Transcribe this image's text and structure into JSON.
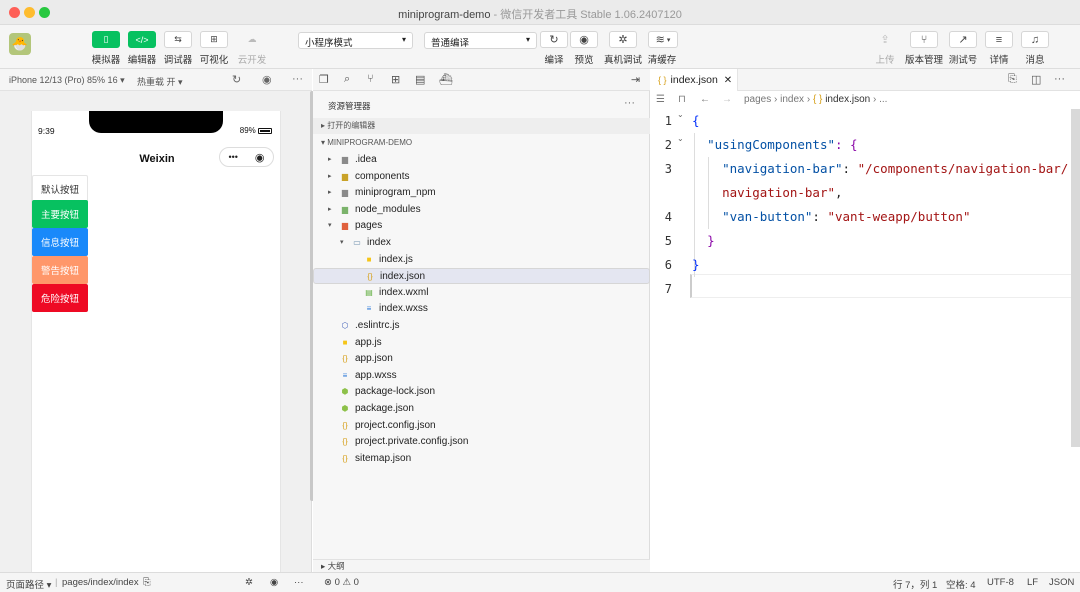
{
  "window": {
    "title": "miniprogram-demo",
    "subtitle": " - 微信开发者工具 Stable 1.06.2407120"
  },
  "toolbar": {
    "left_buttons": [
      {
        "label": "模拟器",
        "icon": "phone-icon",
        "glyph": "▯"
      },
      {
        "label": "编辑器",
        "icon": "code-icon",
        "glyph": "</>"
      },
      {
        "label": "调试器",
        "icon": "debug-icon",
        "glyph": "⇆"
      },
      {
        "label": "可视化",
        "icon": "layout-icon",
        "glyph": "⊞"
      },
      {
        "label": "云开发",
        "icon": "cloud-icon",
        "glyph": "☁"
      }
    ],
    "mode_select": "小程序模式",
    "compile_select": "普通编译",
    "mid_buttons": [
      {
        "label": "编译",
        "icon": "refresh-icon",
        "glyph": "↻"
      },
      {
        "label": "预览",
        "icon": "eye-icon",
        "glyph": "◉"
      },
      {
        "label": "真机调试",
        "icon": "bug-icon",
        "glyph": "✲"
      },
      {
        "label": "清缓存",
        "icon": "layers-icon",
        "glyph": "≋"
      }
    ],
    "right_buttons": [
      {
        "label": "上传",
        "icon": "upload-icon",
        "glyph": "⇪"
      },
      {
        "label": "版本管理",
        "icon": "branch-icon",
        "glyph": "⑂"
      },
      {
        "label": "测试号",
        "icon": "external-icon",
        "glyph": "↗"
      },
      {
        "label": "详情",
        "icon": "menu-icon",
        "glyph": "≡"
      },
      {
        "label": "消息",
        "icon": "bell-icon",
        "glyph": "♫"
      }
    ]
  },
  "simulator": {
    "device": "iPhone 12/13 (Pro) 85% 16 ▾",
    "hot_reload": "热重载 开 ▾",
    "time": "9:39",
    "battery": "89%",
    "page_title": "Weixin",
    "capsule_dots": "•••",
    "buttons": {
      "default": "默认按钮",
      "primary": "主要按钮",
      "info": "信息按钮",
      "warning": "警告按钮",
      "danger": "危险按钮"
    }
  },
  "explorer": {
    "header": "资源管理器",
    "open_editors": "打开的编辑器",
    "project": "MINIPROGRAM-DEMO",
    "outline": "大纲",
    "files": [
      {
        "name": ".idea",
        "depth": 0,
        "arrow": "▸",
        "type": "folder"
      },
      {
        "name": "components",
        "depth": 0,
        "arrow": "▸",
        "type": "folder-comp"
      },
      {
        "name": "miniprogram_npm",
        "depth": 0,
        "arrow": "▸",
        "type": "folder"
      },
      {
        "name": "node_modules",
        "depth": 0,
        "arrow": "▸",
        "type": "folder-node"
      },
      {
        "name": "pages",
        "depth": 0,
        "arrow": "▾",
        "type": "folder-pages"
      },
      {
        "name": "index",
        "depth": 1,
        "arrow": "▾",
        "type": "folder-open"
      },
      {
        "name": "index.js",
        "depth": 2,
        "arrow": "",
        "type": "js"
      },
      {
        "name": "index.json",
        "depth": 2,
        "arrow": "",
        "type": "json",
        "selected": true
      },
      {
        "name": "index.wxml",
        "depth": 2,
        "arrow": "",
        "type": "wxml"
      },
      {
        "name": "index.wxss",
        "depth": 2,
        "arrow": "",
        "type": "wxss"
      },
      {
        "name": ".eslintrc.js",
        "depth": 0,
        "arrow": "",
        "type": "eslint"
      },
      {
        "name": "app.js",
        "depth": 0,
        "arrow": "",
        "type": "js"
      },
      {
        "name": "app.json",
        "depth": 0,
        "arrow": "",
        "type": "json"
      },
      {
        "name": "app.wxss",
        "depth": 0,
        "arrow": "",
        "type": "wxss"
      },
      {
        "name": "package-lock.json",
        "depth": 0,
        "arrow": "",
        "type": "npm"
      },
      {
        "name": "package.json",
        "depth": 0,
        "arrow": "",
        "type": "npm"
      },
      {
        "name": "project.config.json",
        "depth": 0,
        "arrow": "",
        "type": "json"
      },
      {
        "name": "project.private.config.json",
        "depth": 0,
        "arrow": "",
        "type": "json"
      },
      {
        "name": "sitemap.json",
        "depth": 0,
        "arrow": "",
        "type": "json"
      }
    ]
  },
  "editor": {
    "tab": "index.json",
    "breadcrumb": [
      "pages",
      "index",
      "index.json",
      "..."
    ],
    "line_numbers": [
      "1",
      "2",
      "3",
      "",
      "4",
      "5",
      "6",
      "7"
    ],
    "code": {
      "l1": "{",
      "l2_key": "\"usingComponents\"",
      "l2_rest": ": {",
      "l3_key": "\"navigation-bar\"",
      "l3_val": "\"/components/navigation-bar/",
      "l3b_val": "navigation-bar\"",
      "l4_key": "\"van-button\"",
      "l4_val": "\"vant-weapp/button\"",
      "l5": "}",
      "l6": "}"
    }
  },
  "statusbar": {
    "page_path_label": "页面路径 ▾",
    "page_path": "pages/index/index",
    "problems": "⊗ 0 ⚠ 0",
    "cursor": "行 7，列 1",
    "indent": "空格: 4",
    "encoding": "UTF-8",
    "eol": "LF",
    "language": "JSON"
  },
  "colors": {
    "green": "#07c160",
    "info": "#1989fa",
    "warning": "#ff976a",
    "danger": "#ee0a24"
  }
}
